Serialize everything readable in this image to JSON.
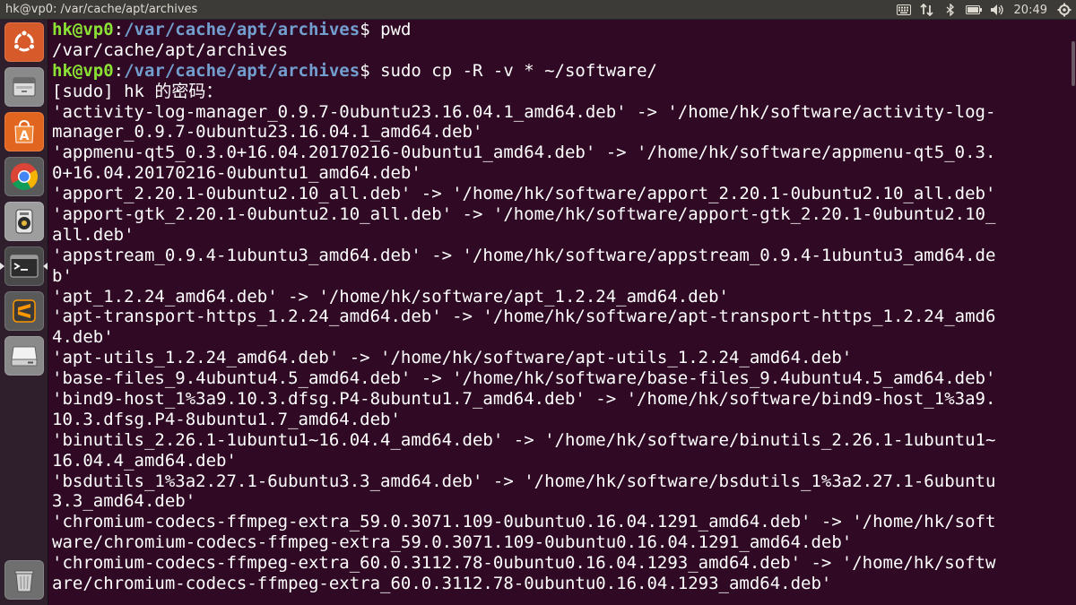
{
  "window": {
    "title": "hk@vp0: /var/cache/apt/archives"
  },
  "panel": {
    "clock": "20:49"
  },
  "launcher": {
    "items": [
      {
        "name": "ubuntu-dash-icon",
        "color": "#d65a2a"
      },
      {
        "name": "files-icon",
        "color": "#8a8a8a"
      },
      {
        "name": "software-center-icon",
        "color": "#e2651f"
      },
      {
        "name": "chrome-icon",
        "color": "#5a5a5a"
      },
      {
        "name": "rhythmbox-icon",
        "color": "#9e9e9e"
      },
      {
        "name": "terminal-icon",
        "color": "#4a4a4a"
      },
      {
        "name": "sublime-text-icon",
        "color": "#5a5a5a"
      },
      {
        "name": "disk-icon",
        "color": "#8a8a8a"
      },
      {
        "name": "trash-icon",
        "color": "#6f6f6f"
      }
    ]
  },
  "terminal": {
    "lines": [
      {
        "type": "prompt",
        "user": "hk@vp0",
        "path": "/var/cache/apt/archives",
        "cmd": " pwd"
      },
      {
        "type": "out",
        "text": "/var/cache/apt/archives"
      },
      {
        "type": "prompt",
        "user": "hk@vp0",
        "path": "/var/cache/apt/archives",
        "cmd": " sudo cp -R -v * ~/software/"
      },
      {
        "type": "out",
        "text": "[sudo] hk 的密码："
      },
      {
        "type": "out",
        "text": "'activity-log-manager_0.9.7-0ubuntu23.16.04.1_amd64.deb' -> '/home/hk/software/activity-log-"
      },
      {
        "type": "out",
        "text": "manager_0.9.7-0ubuntu23.16.04.1_amd64.deb'"
      },
      {
        "type": "out",
        "text": "'appmenu-qt5_0.3.0+16.04.20170216-0ubuntu1_amd64.deb' -> '/home/hk/software/appmenu-qt5_0.3."
      },
      {
        "type": "out",
        "text": "0+16.04.20170216-0ubuntu1_amd64.deb'"
      },
      {
        "type": "out",
        "text": "'apport_2.20.1-0ubuntu2.10_all.deb' -> '/home/hk/software/apport_2.20.1-0ubuntu2.10_all.deb'"
      },
      {
        "type": "out",
        "text": "'apport-gtk_2.20.1-0ubuntu2.10_all.deb' -> '/home/hk/software/apport-gtk_2.20.1-0ubuntu2.10_"
      },
      {
        "type": "out",
        "text": "all.deb'"
      },
      {
        "type": "out",
        "text": "'appstream_0.9.4-1ubuntu3_amd64.deb' -> '/home/hk/software/appstream_0.9.4-1ubuntu3_amd64.de"
      },
      {
        "type": "out",
        "text": "b'"
      },
      {
        "type": "out",
        "text": "'apt_1.2.24_amd64.deb' -> '/home/hk/software/apt_1.2.24_amd64.deb'"
      },
      {
        "type": "out",
        "text": "'apt-transport-https_1.2.24_amd64.deb' -> '/home/hk/software/apt-transport-https_1.2.24_amd6"
      },
      {
        "type": "out",
        "text": "4.deb'"
      },
      {
        "type": "out",
        "text": "'apt-utils_1.2.24_amd64.deb' -> '/home/hk/software/apt-utils_1.2.24_amd64.deb'"
      },
      {
        "type": "out",
        "text": "'base-files_9.4ubuntu4.5_amd64.deb' -> '/home/hk/software/base-files_9.4ubuntu4.5_amd64.deb'"
      },
      {
        "type": "out",
        "text": "'bind9-host_1%3a9.10.3.dfsg.P4-8ubuntu1.7_amd64.deb' -> '/home/hk/software/bind9-host_1%3a9."
      },
      {
        "type": "out",
        "text": "10.3.dfsg.P4-8ubuntu1.7_amd64.deb'"
      },
      {
        "type": "out",
        "text": "'binutils_2.26.1-1ubuntu1~16.04.4_amd64.deb' -> '/home/hk/software/binutils_2.26.1-1ubuntu1~"
      },
      {
        "type": "out",
        "text": "16.04.4_amd64.deb'"
      },
      {
        "type": "out",
        "text": "'bsdutils_1%3a2.27.1-6ubuntu3.3_amd64.deb' -> '/home/hk/software/bsdutils_1%3a2.27.1-6ubuntu"
      },
      {
        "type": "out",
        "text": "3.3_amd64.deb'"
      },
      {
        "type": "out",
        "text": "'chromium-codecs-ffmpeg-extra_59.0.3071.109-0ubuntu0.16.04.1291_amd64.deb' -> '/home/hk/soft"
      },
      {
        "type": "out",
        "text": "ware/chromium-codecs-ffmpeg-extra_59.0.3071.109-0ubuntu0.16.04.1291_amd64.deb'"
      },
      {
        "type": "out",
        "text": "'chromium-codecs-ffmpeg-extra_60.0.3112.78-0ubuntu0.16.04.1293_amd64.deb' -> '/home/hk/softw"
      },
      {
        "type": "out",
        "text": "are/chromium-codecs-ffmpeg-extra_60.0.3112.78-0ubuntu0.16.04.1293_amd64.deb'"
      }
    ]
  }
}
